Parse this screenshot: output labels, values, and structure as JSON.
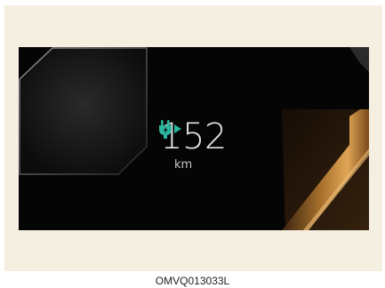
{
  "display": {
    "range_value": "152",
    "range_unit": "km",
    "icon": "ev-plug-charging-icon",
    "icon_color": "#29b59e"
  },
  "caption": "OMVQ013033L",
  "colors": {
    "frame_background": "#f5efe1",
    "screen_background": "#050505",
    "accent_bronze": "#c98a3a"
  }
}
